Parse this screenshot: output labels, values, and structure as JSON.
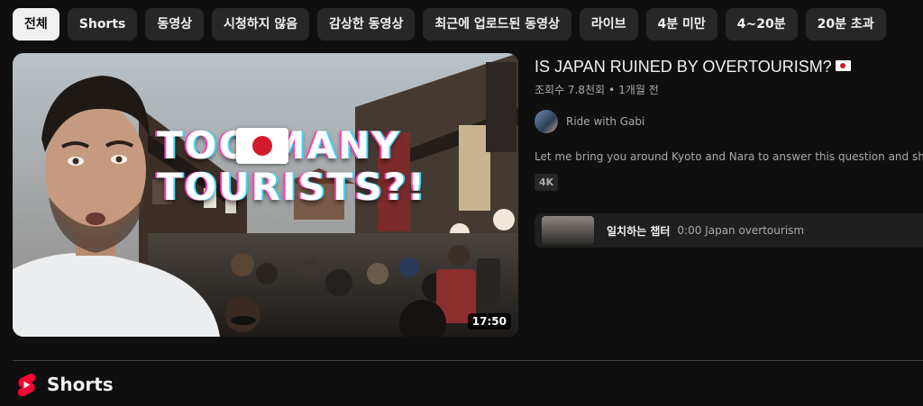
{
  "chips": [
    {
      "label": "전체",
      "active": true
    },
    {
      "label": "Shorts",
      "active": false
    },
    {
      "label": "동영상",
      "active": false
    },
    {
      "label": "시청하지 않음",
      "active": false
    },
    {
      "label": "감상한 동영상",
      "active": false
    },
    {
      "label": "최근에 업로드된 동영상",
      "active": false
    },
    {
      "label": "라이브",
      "active": false
    },
    {
      "label": "4분 미만",
      "active": false
    },
    {
      "label": "4~20분",
      "active": false
    },
    {
      "label": "20분 초과",
      "active": false
    }
  ],
  "video": {
    "thumbnail_headline": "TOO MANY TOURISTS?!",
    "duration": "17:50",
    "title": "IS JAPAN RUINED BY OVERTOURISM?",
    "title_flag_icon": "japan-flag-icon",
    "views": "조회수 7.8천회",
    "separator": "•",
    "age": "1개월 전",
    "channel": "Ride with Gabi",
    "description": "Let me bring you around Kyoto and Nara to answer this question and sha",
    "quality_badge": "4K",
    "chapter": {
      "label": "일치하는 챕터",
      "time_title": "0:00 Japan overtourism"
    }
  },
  "shorts_section": {
    "title": "Shorts",
    "icon": "shorts-logo-icon"
  },
  "colors": {
    "background": "#0f0f0f",
    "chip": "#272727",
    "chip_active": "#f1f1f1",
    "shorts_red": "#ff0033",
    "flag_red": "#d31b2c"
  }
}
